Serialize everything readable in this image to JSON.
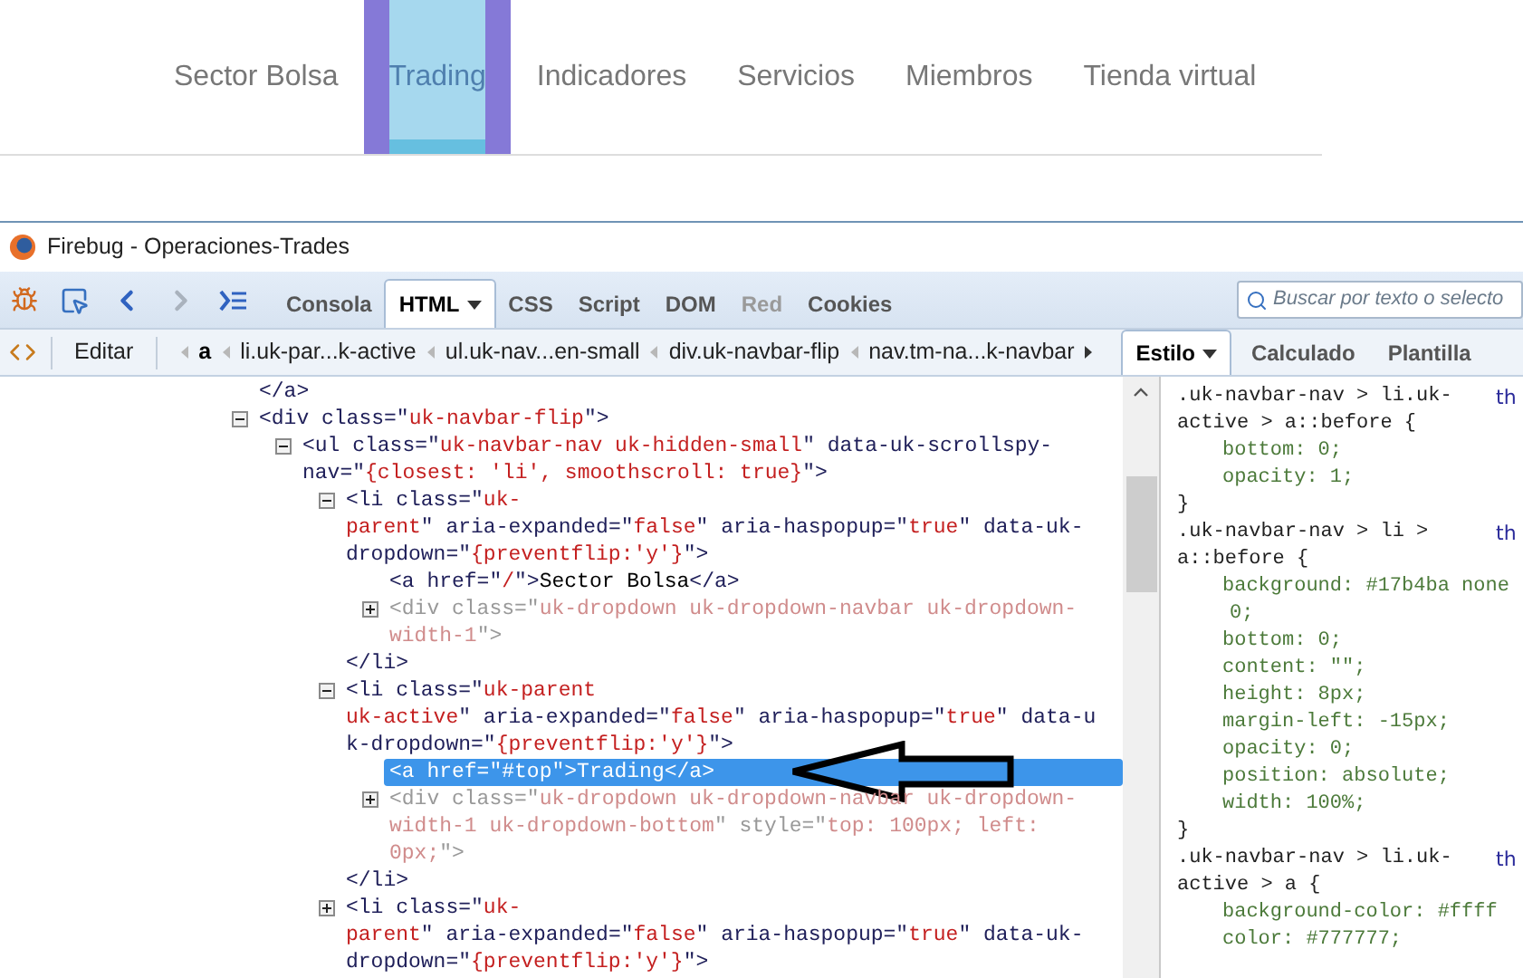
{
  "site_nav": {
    "items": [
      {
        "label": "Sector Bolsa",
        "selected": false
      },
      {
        "label": "Trading",
        "selected": true
      },
      {
        "label": "Indicadores",
        "selected": false
      },
      {
        "label": "Servicios",
        "selected": false
      },
      {
        "label": "Miembros",
        "selected": false
      },
      {
        "label": "Tienda virtual",
        "selected": false
      }
    ]
  },
  "window": {
    "title": "Firebug - Operaciones-Trades"
  },
  "toolbar": {
    "tabs": [
      {
        "label": "Consola",
        "selected": false,
        "disabled": false,
        "has_menu": false
      },
      {
        "label": "HTML",
        "selected": true,
        "disabled": false,
        "has_menu": true
      },
      {
        "label": "CSS",
        "selected": false,
        "disabled": false,
        "has_menu": false
      },
      {
        "label": "Script",
        "selected": false,
        "disabled": false,
        "has_menu": false
      },
      {
        "label": "DOM",
        "selected": false,
        "disabled": false,
        "has_menu": false
      },
      {
        "label": "Red",
        "selected": false,
        "disabled": true,
        "has_menu": false
      },
      {
        "label": "Cookies",
        "selected": false,
        "disabled": false,
        "has_menu": false
      }
    ],
    "search": {
      "placeholder": "Buscar por texto o selecto"
    }
  },
  "breadcrumb_bar": {
    "edit_button": "Editar",
    "crumbs": [
      {
        "label": "a",
        "selected": true
      },
      {
        "label": "li.uk-par...k-active",
        "selected": false
      },
      {
        "label": "ul.uk-nav...en-small",
        "selected": false
      },
      {
        "label": "div.uk-navbar-flip",
        "selected": false
      },
      {
        "label": "nav.tm-na...k-navbar",
        "selected": false
      }
    ],
    "side_tabs": [
      {
        "label": "Estilo",
        "selected": true,
        "has_menu": true
      },
      {
        "label": "Calculado",
        "selected": false,
        "has_menu": false
      },
      {
        "label": "Plantilla",
        "selected": false,
        "has_menu": false
      }
    ]
  },
  "html_tree": [
    {
      "dimmed": false,
      "selected": false,
      "lines": [
        [
          {
            "kind": "tag",
            "text": "</a>"
          }
        ]
      ]
    },
    {
      "expanded": true,
      "dimmed": false,
      "selected": false,
      "lines": [
        [
          {
            "kind": "tag",
            "text": "<div class=\""
          },
          {
            "kind": "value",
            "text": "uk-navbar-flip"
          },
          {
            "kind": "tag",
            "text": "\">"
          }
        ]
      ],
      "children": [
        {
          "expanded": true,
          "dimmed": false,
          "selected": false,
          "lines": [
            [
              {
                "kind": "tag",
                "text": "<ul class=\""
              },
              {
                "kind": "value",
                "text": "uk-navbar-nav uk-hidden-small"
              },
              {
                "kind": "tag",
                "text": "\" data-uk-scrollspy-"
              }
            ],
            [
              {
                "kind": "tag",
                "text": "nav=\""
              },
              {
                "kind": "value",
                "text": "{closest: 'li', smoothscroll: true}"
              },
              {
                "kind": "tag",
                "text": "\">"
              }
            ]
          ],
          "children": [
            {
              "expanded": true,
              "dimmed": false,
              "selected": false,
              "lines": [
                [
                  {
                    "kind": "tag",
                    "text": "<li class=\""
                  },
                  {
                    "kind": "value",
                    "text": "uk-"
                  }
                ],
                [
                  {
                    "kind": "value",
                    "text": "parent"
                  },
                  {
                    "kind": "tag",
                    "text": "\" aria-expanded=\""
                  },
                  {
                    "kind": "value",
                    "text": "false"
                  },
                  {
                    "kind": "tag",
                    "text": "\" aria-haspopup=\""
                  },
                  {
                    "kind": "value",
                    "text": "true"
                  },
                  {
                    "kind": "tag",
                    "text": "\" data-uk-"
                  }
                ],
                [
                  {
                    "kind": "tag",
                    "text": "dropdown=\""
                  },
                  {
                    "kind": "value",
                    "text": "{preventflip:'y'}"
                  },
                  {
                    "kind": "tag",
                    "text": "\">"
                  }
                ]
              ],
              "children": [
                {
                  "dimmed": false,
                  "selected": false,
                  "lines": [
                    [
                      {
                        "kind": "tag",
                        "text": "<a href=\""
                      },
                      {
                        "kind": "value",
                        "text": "/"
                      },
                      {
                        "kind": "tag",
                        "text": "\">"
                      },
                      {
                        "kind": "text",
                        "text": "Sector Bolsa"
                      },
                      {
                        "kind": "tag",
                        "text": "</a>"
                      }
                    ]
                  ]
                },
                {
                  "expanded": false,
                  "dimmed": true,
                  "selected": false,
                  "lines": [
                    [
                      {
                        "kind": "tag",
                        "text": "<div class=\""
                      },
                      {
                        "kind": "value",
                        "text": "uk-dropdown uk-dropdown-navbar uk-dropdown-"
                      }
                    ],
                    [
                      {
                        "kind": "value",
                        "text": "width-1"
                      },
                      {
                        "kind": "tag",
                        "text": "\">"
                      }
                    ]
                  ]
                }
              ],
              "closing": "</li>"
            },
            {
              "expanded": true,
              "dimmed": false,
              "selected": false,
              "lines": [
                [
                  {
                    "kind": "tag",
                    "text": "<li class=\""
                  },
                  {
                    "kind": "value",
                    "text": "uk-parent"
                  }
                ],
                [
                  {
                    "kind": "value",
                    "text": "uk-active"
                  },
                  {
                    "kind": "tag",
                    "text": "\" aria-expanded=\""
                  },
                  {
                    "kind": "value",
                    "text": "false"
                  },
                  {
                    "kind": "tag",
                    "text": "\" aria-haspopup=\""
                  },
                  {
                    "kind": "value",
                    "text": "true"
                  },
                  {
                    "kind": "tag",
                    "text": "\" data-u"
                  }
                ],
                [
                  {
                    "kind": "tag",
                    "text": "k-dropdown=\""
                  },
                  {
                    "kind": "value",
                    "text": "{preventflip:'y'}"
                  },
                  {
                    "kind": "tag",
                    "text": "\">"
                  }
                ]
              ],
              "children": [
                {
                  "dimmed": false,
                  "selected": true,
                  "lines": [
                    [
                      {
                        "kind": "tag",
                        "text": "<a href=\""
                      },
                      {
                        "kind": "value",
                        "text": "#top"
                      },
                      {
                        "kind": "tag",
                        "text": "\">"
                      },
                      {
                        "kind": "text",
                        "text": "Trading"
                      },
                      {
                        "kind": "tag",
                        "text": "</a>"
                      }
                    ]
                  ]
                },
                {
                  "expanded": false,
                  "dimmed": true,
                  "selected": false,
                  "lines": [
                    [
                      {
                        "kind": "tag",
                        "text": "<div class=\""
                      },
                      {
                        "kind": "value",
                        "text": "uk-dropdown uk-dropdown-navbar uk-dropdown-"
                      }
                    ],
                    [
                      {
                        "kind": "value",
                        "text": "width-1 uk-dropdown-bottom"
                      },
                      {
                        "kind": "tag",
                        "text": "\" style=\""
                      },
                      {
                        "kind": "value",
                        "text": "top: 100px; left:"
                      }
                    ],
                    [
                      {
                        "kind": "value",
                        "text": "0px;"
                      },
                      {
                        "kind": "tag",
                        "text": "\">"
                      }
                    ]
                  ]
                }
              ],
              "closing": "</li>"
            },
            {
              "expanded": false,
              "dimmed": false,
              "selected": false,
              "lines": [
                [
                  {
                    "kind": "tag",
                    "text": "<li class=\""
                  },
                  {
                    "kind": "value",
                    "text": "uk-"
                  }
                ],
                [
                  {
                    "kind": "value",
                    "text": "parent"
                  },
                  {
                    "kind": "tag",
                    "text": "\" aria-expanded=\""
                  },
                  {
                    "kind": "value",
                    "text": "false"
                  },
                  {
                    "kind": "tag",
                    "text": "\" aria-haspopup=\""
                  },
                  {
                    "kind": "value",
                    "text": "true"
                  },
                  {
                    "kind": "tag",
                    "text": "\" data-uk-"
                  }
                ],
                [
                  {
                    "kind": "tag",
                    "text": "dropdown=\""
                  },
                  {
                    "kind": "value",
                    "text": "{preventflip:'y'}"
                  },
                  {
                    "kind": "tag",
                    "text": "\">"
                  }
                ]
              ]
            }
          ]
        }
      ]
    }
  ],
  "style_rules": [
    {
      "selector": [
        ".uk-navbar-nav > li.uk-",
        "active > a::before {"
      ],
      "source": "th",
      "declarations": [
        [
          "bottom: 0;"
        ],
        [
          "opacity: 1;"
        ]
      ],
      "closing": "}"
    },
    {
      "selector": [
        ".uk-navbar-nav > li >",
        "a::before {"
      ],
      "source": "th",
      "declarations": [
        [
          "background: #17b4ba none",
          "0;"
        ],
        [
          "bottom: 0;"
        ],
        [
          "content: \"\";"
        ],
        [
          "height: 8px;"
        ],
        [
          "margin-left: -15px;"
        ],
        [
          "opacity: 0;"
        ],
        [
          "position: absolute;"
        ],
        [
          "width: 100%;"
        ]
      ],
      "closing": "}"
    },
    {
      "selector": [
        ".uk-navbar-nav > li.uk-",
        "active > a {"
      ],
      "source": "th",
      "declarations": [
        [
          "background-color: #ffff"
        ],
        [
          "color: #777777;"
        ]
      ]
    }
  ]
}
